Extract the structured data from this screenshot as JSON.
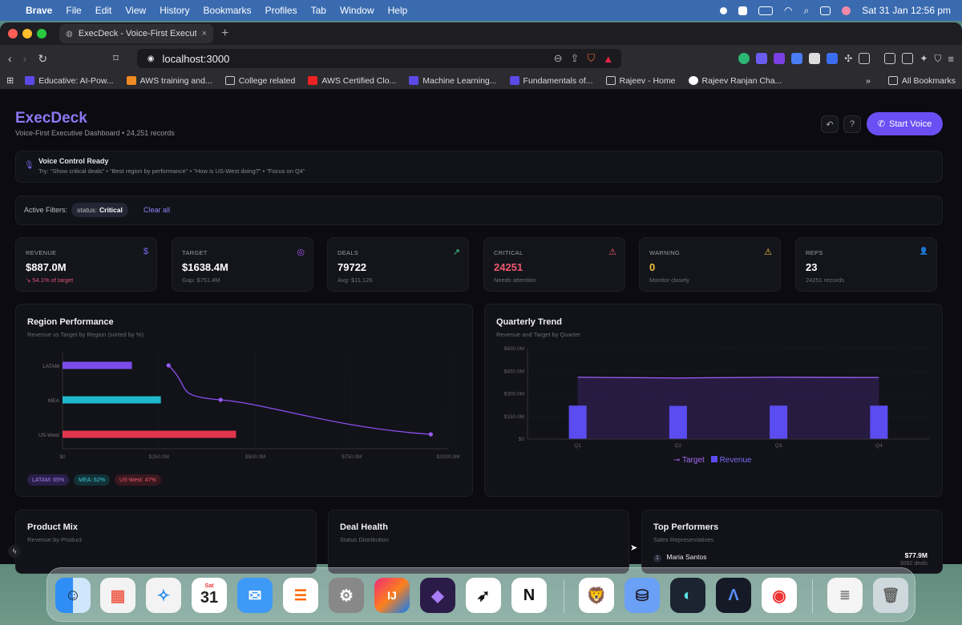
{
  "menubar": {
    "app": "Brave",
    "items": [
      "File",
      "Edit",
      "View",
      "History",
      "Bookmarks",
      "Profiles",
      "Tab",
      "Window",
      "Help"
    ],
    "datetime": "Sat 31 Jan  12:56 pm"
  },
  "browser": {
    "tab_title": "ExecDeck - Voice-First Executi",
    "url": "localhost:3000",
    "bookmarks": [
      "Educative: AI-Pow...",
      "AWS training and...",
      "College related",
      "AWS Certified Clo...",
      "Machine Learning...",
      "Fundamentals of...",
      "Rajeev - Home",
      "Rajeev Ranjan Cha..."
    ],
    "all_bookmarks": "All Bookmarks"
  },
  "header": {
    "title": "ExecDeck",
    "subtitle": "Voice-First Executive Dashboard • 24,251 records",
    "start_voice": "Start Voice"
  },
  "voice": {
    "title": "Voice Control Ready",
    "hint": "Try: \"Show critical deals\" • \"Best region by performance\" • \"How is US-West doing?\" • \"Focus on Q4\""
  },
  "filters": {
    "label": "Active Filters:",
    "chip_key": "status:",
    "chip_value": "Critical",
    "clear": "Clear all"
  },
  "kpis": [
    {
      "label": "REVENUE",
      "value": "$887.0M",
      "sub": "↘ 54.1% of target",
      "icon": "$",
      "color": "#7b68ee",
      "sub_color": "#e05577"
    },
    {
      "label": "TARGET",
      "value": "$1638.4M",
      "sub": "Gap: $751.4M",
      "icon": "◎",
      "color": "#a25cf0",
      "sub_color": "#6e6e7c"
    },
    {
      "label": "DEALS",
      "value": "79722",
      "sub": "Avg: $11,126",
      "icon": "↗",
      "color": "#3ecf8e",
      "sub_color": "#6e6e7c"
    },
    {
      "label": "CRITICAL",
      "value": "24251",
      "sub": "Needs attention",
      "icon": "⚠",
      "color": "#ef5a6f",
      "sub_color": "#6e6e7c",
      "value_color": "#ef5a6f"
    },
    {
      "label": "WARNING",
      "value": "0",
      "sub": "Monitor closely",
      "icon": "⚠",
      "color": "#f0c23c",
      "sub_color": "#6e6e7c",
      "value_color": "#f0c23c"
    },
    {
      "label": "REPS",
      "value": "23",
      "sub": "24251 records",
      "icon": "👤",
      "color": "#6f8df5",
      "sub_color": "#6e6e7c"
    }
  ],
  "region_chart": {
    "title": "Region Performance",
    "subtitle": "Revenue vs Target by Region (sorted by %)",
    "legend": [
      "LATAM: 65%",
      "MEA: 62%",
      "US-West: 47%"
    ]
  },
  "quarterly_chart": {
    "title": "Quarterly Trend",
    "subtitle": "Revenue and Target by Quarter",
    "legend_target": "Target",
    "legend_revenue": "Revenue"
  },
  "bottom": {
    "product_title": "Product Mix",
    "product_sub": "Revenue by Product",
    "health_title": "Deal Health",
    "health_sub": "Status Distribution",
    "top_title": "Top Performers",
    "top_sub": "Sales Representatives",
    "top_rank": "1",
    "top_name": "Maria Santos",
    "top_value": "$77.9M",
    "top_deals": "3092 deals"
  },
  "chart_data": [
    {
      "type": "bar",
      "orientation": "horizontal",
      "title": "Region Performance",
      "categories": [
        "LATAM",
        "MEA",
        "US-West"
      ],
      "series": [
        {
          "type": "bar",
          "values": [
            180,
            255,
            450
          ]
        },
        {
          "type": "line",
          "values": [
            275,
            410,
            955
          ]
        }
      ],
      "bar_colors": [
        "#7c4dea",
        "#1eb8cc",
        "#e0364e"
      ],
      "x_ticks": [
        "$0",
        "$250.0M",
        "$500.0M",
        "$750.0M",
        "$1000.0M"
      ],
      "xlim": [
        0,
        1000
      ]
    },
    {
      "type": "bar",
      "title": "Quarterly Trend",
      "categories": [
        "Q1",
        "Q2",
        "Q3",
        "Q4"
      ],
      "series": [
        {
          "name": "Revenue",
          "type": "bar",
          "values": [
            222,
            220,
            222,
            222
          ]
        },
        {
          "name": "Target",
          "type": "area",
          "values": [
            410,
            405,
            410,
            408
          ]
        }
      ],
      "y_ticks": [
        "$0",
        "$150.0M",
        "$300.0M",
        "$450.0M",
        "$600.0M"
      ],
      "ylim": [
        0,
        600
      ],
      "grid": true,
      "legend": "bottom"
    }
  ]
}
